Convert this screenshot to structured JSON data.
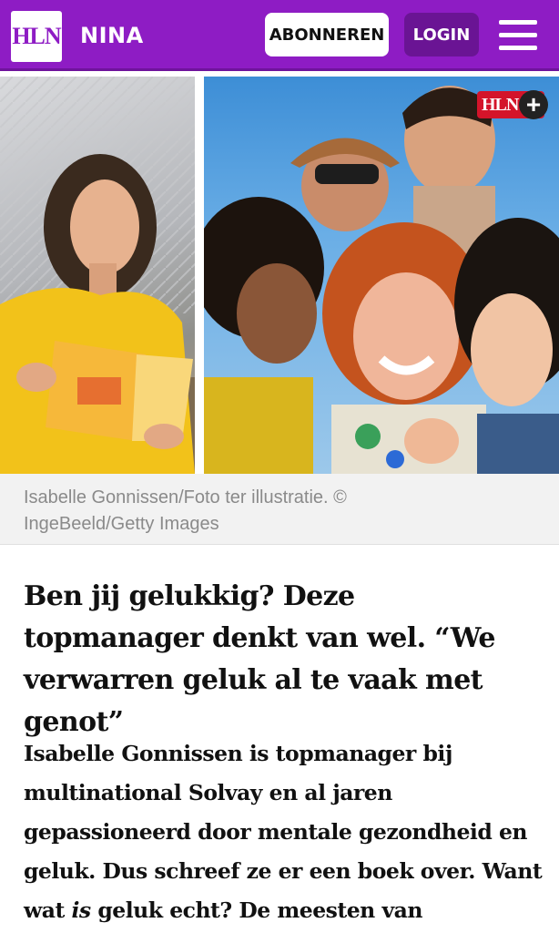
{
  "header": {
    "logo_text": "HLN",
    "section": "NINA",
    "subscribe_label": "ABONNEREN",
    "login_label": "LOGIN",
    "colors": {
      "brand": "#8e1cc4",
      "login": "#6a1494"
    }
  },
  "hero": {
    "left_photo": "woman-reading-book-photo",
    "right_photo": "group-of-friends-photo",
    "premium_badge": "HLN",
    "premium_badge_icon": "plus-icon"
  },
  "caption": {
    "line1": "Isabelle Gonnissen/Foto ter illustratie. ©",
    "line2": "IngeBeeld/Getty Images"
  },
  "article": {
    "headline": "Ben jij gelukkig? Deze topmanager denkt van wel. “We verwarren geluk al te vaak met genot”",
    "intro_part1": "Isabelle Gonnissen is topmanager bij multinational Solvay en al jaren gepassioneerd door mentale gezondheid en geluk. Dus schreef ze er een boek over. Want wat ",
    "intro_em": "is",
    "intro_part2": " geluk echt? De meesten van"
  }
}
